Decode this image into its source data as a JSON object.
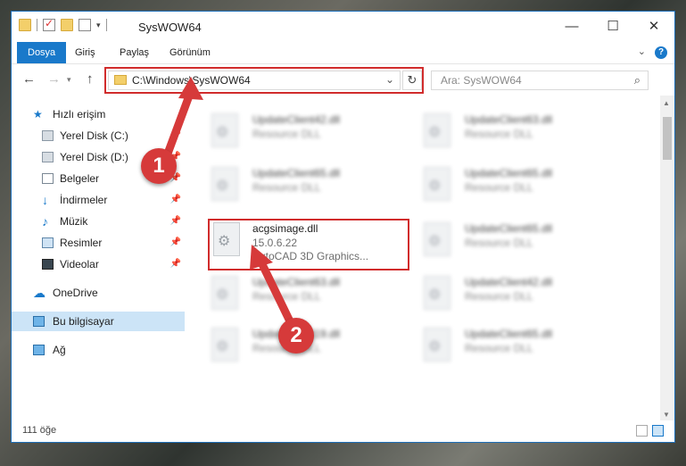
{
  "window": {
    "title": "SysWOW64"
  },
  "menu": {
    "file": "Dosya",
    "home": "Giriş",
    "share": "Paylaş",
    "view": "Görünüm",
    "help": "?"
  },
  "nav_bar": {
    "address": "C:\\Windows\\SysWOW64",
    "search_placeholder": "Ara: SysWOW64"
  },
  "sidebar": {
    "quick_access": "Hızlı erişim",
    "items": [
      {
        "label": "Yerel Disk (C:)",
        "icon": "drive-icon"
      },
      {
        "label": "Yerel Disk (D:)",
        "icon": "drive-icon"
      },
      {
        "label": "Belgeler",
        "icon": "documents-icon"
      },
      {
        "label": "İndirmeler",
        "icon": "download-icon"
      },
      {
        "label": "Müzik",
        "icon": "music-icon"
      },
      {
        "label": "Resimler",
        "icon": "pictures-icon"
      },
      {
        "label": "Videolar",
        "icon": "videos-icon"
      }
    ],
    "onedrive": "OneDrive",
    "this_pc": "Bu bilgisayar",
    "network": "Ağ"
  },
  "files": [
    {
      "name": "UpdateClient42.dll",
      "desc": "Resource DLL"
    },
    {
      "name": "UpdateClient63.dll",
      "desc": "Resource DLL"
    },
    {
      "name": "UpdateClient65.dll",
      "desc": "Resource DLL"
    },
    {
      "name": "UpdateClient65.dll",
      "desc": "Resource DLL"
    },
    {
      "name": "acgsimage.dll",
      "version": "15.0.6.22",
      "desc": "AutoCAD 3D Graphics..."
    },
    {
      "name": "UpdateClient65.dll",
      "desc": "Resource DLL"
    },
    {
      "name": "UpdateClient63.dll",
      "desc": "Resource DLL"
    },
    {
      "name": "UpdateClient42.dll",
      "desc": "Resource DLL"
    },
    {
      "name": "UpdateClient19.dll",
      "desc": "Resource DLL"
    },
    {
      "name": "UpdateClient65.dll",
      "desc": "Resource DLL"
    }
  ],
  "status": {
    "count": "111 öğe"
  },
  "annotations": {
    "marker1": "1",
    "marker2": "2"
  },
  "colors": {
    "accent": "#1979ca",
    "highlight": "#d12c2c",
    "marker": "#d63a3a"
  }
}
